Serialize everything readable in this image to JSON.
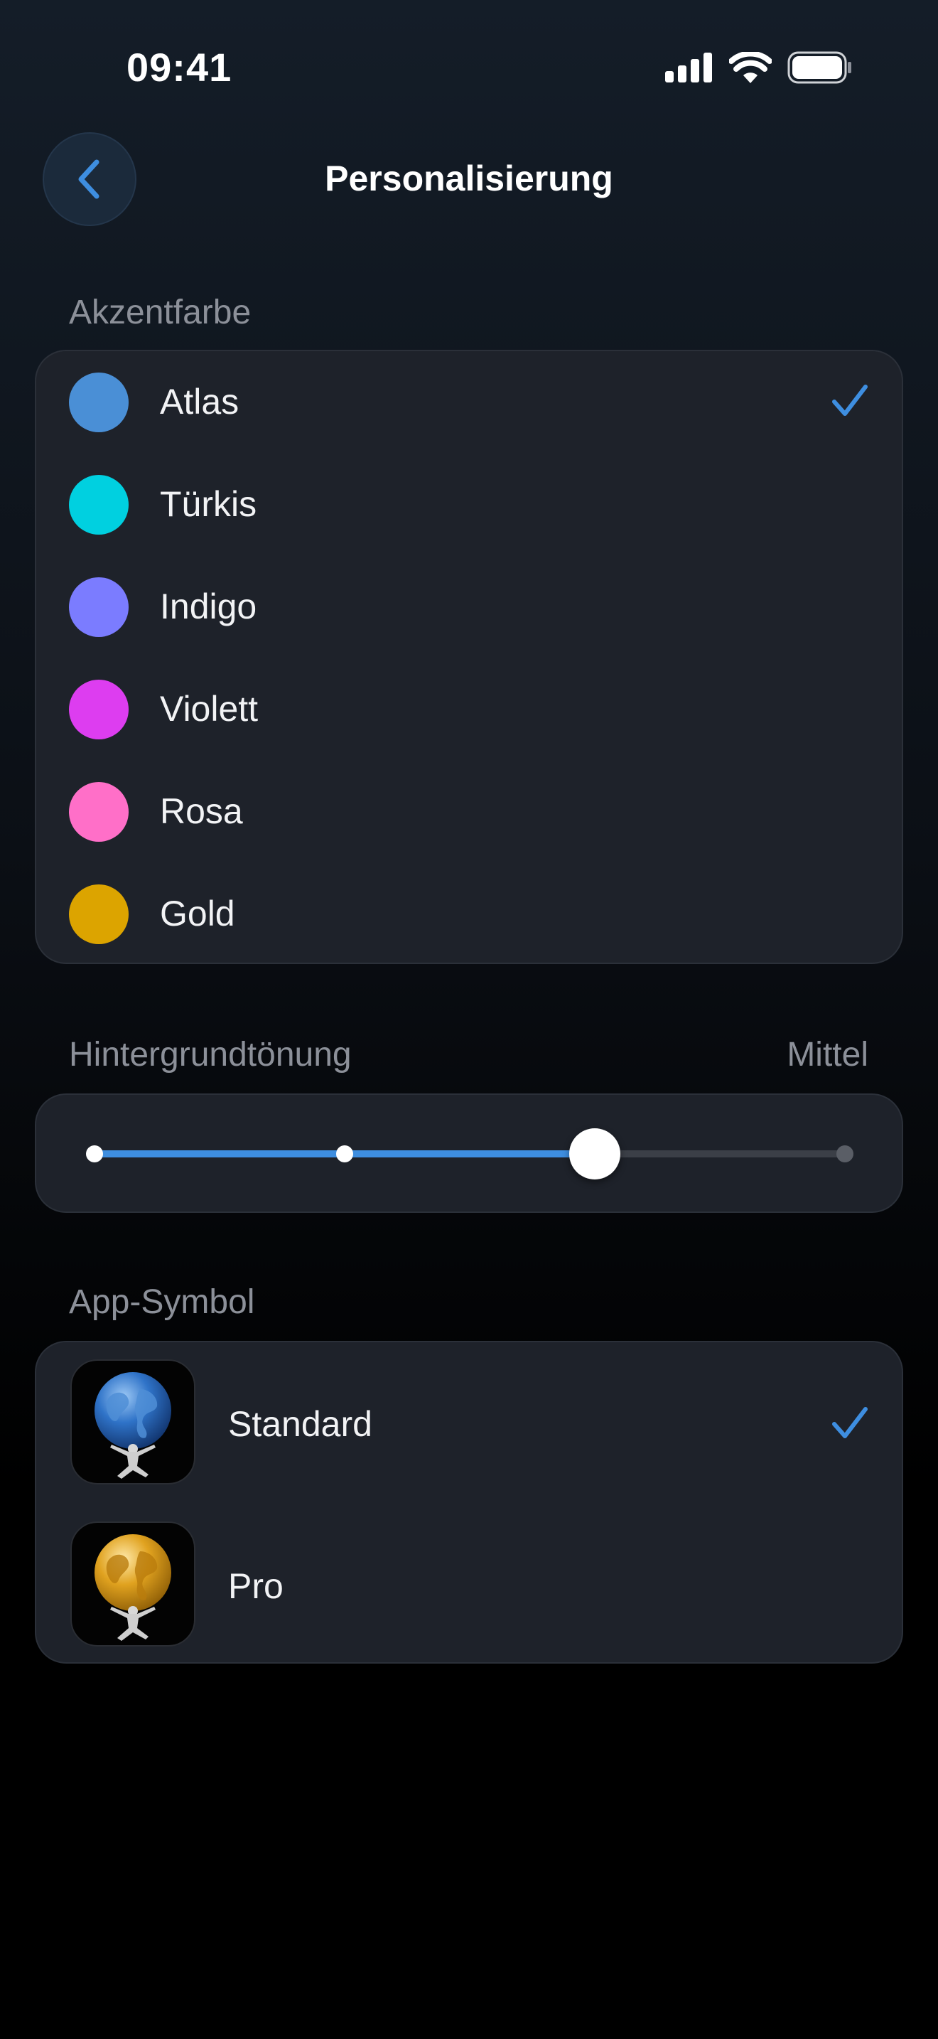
{
  "status_bar": {
    "time": "09:41"
  },
  "nav": {
    "title": "Personalisierung",
    "back_icon": "chevron-left-icon"
  },
  "accent": {
    "section_label": "Akzentfarbe",
    "selected": "Atlas",
    "colors": [
      {
        "label": "Atlas",
        "color": "#4a8fd6",
        "selected": true
      },
      {
        "label": "Türkis",
        "color": "#00d0e0",
        "selected": false
      },
      {
        "label": "Indigo",
        "color": "#7b7cff",
        "selected": false
      },
      {
        "label": "Violett",
        "color": "#dd3df0",
        "selected": false
      },
      {
        "label": "Rosa",
        "color": "#ff6fc8",
        "selected": false
      },
      {
        "label": "Gold",
        "color": "#dca400",
        "selected": false
      }
    ]
  },
  "tint": {
    "section_label": "Hintergrundtönung",
    "value_label": "Mittel",
    "steps": 4,
    "selected_step": 3
  },
  "app_icon": {
    "section_label": "App-Symbol",
    "options": [
      {
        "label": "Standard",
        "globe_color": "#2f73c8",
        "selected": true
      },
      {
        "label": "Pro",
        "globe_color": "#e0a21f",
        "selected": false
      }
    ]
  },
  "colors": {
    "accent": "#3e8ee0",
    "card_background": "#1e222a",
    "label_secondary": "#8c9099"
  }
}
